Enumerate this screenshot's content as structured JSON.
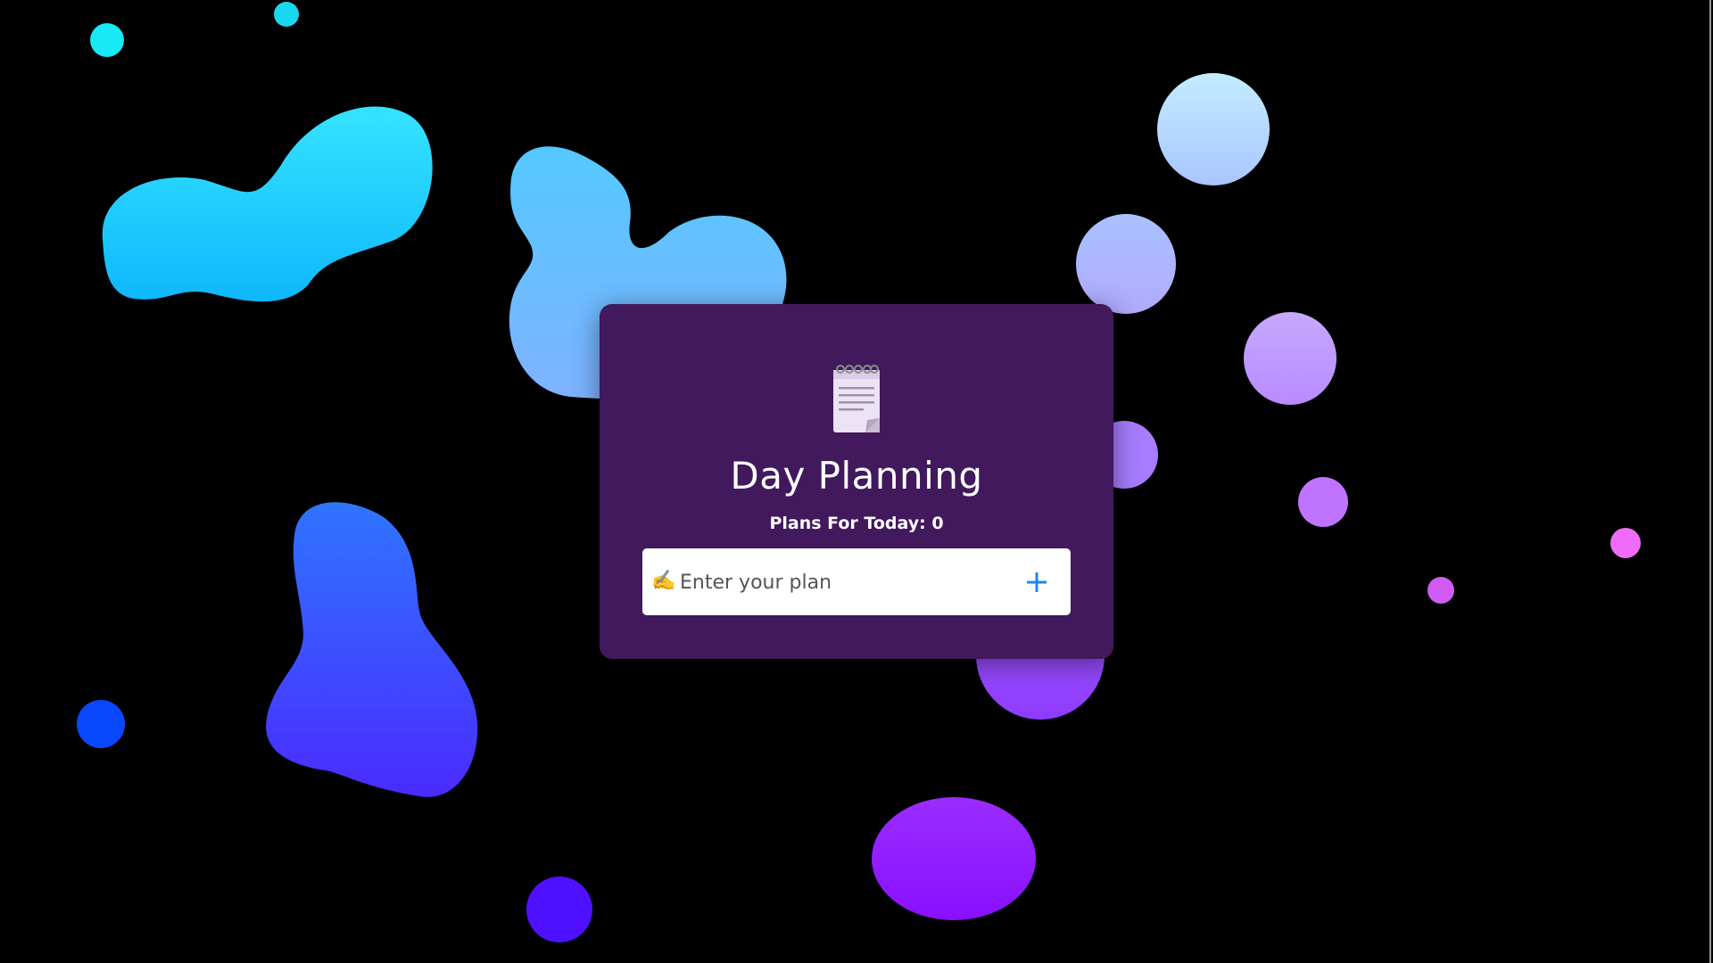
{
  "app": {
    "title": "Day Planning",
    "count_label": "Plans For Today: 0",
    "input_emoji": "✍️",
    "input_placeholder": "Enter your plan",
    "add_icon": "plus-icon",
    "notepad_icon": "notepad-icon"
  },
  "colors": {
    "background": "#000000",
    "card": "#41195c",
    "input_bg": "#ffffff",
    "accent": "#1e88e5"
  }
}
